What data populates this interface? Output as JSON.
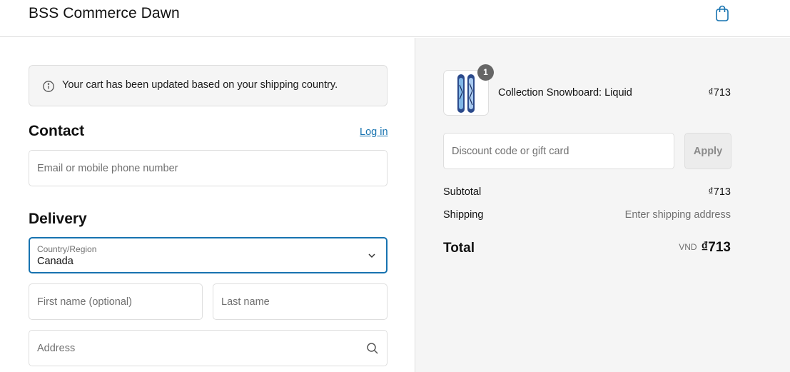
{
  "header": {
    "brand": "BSS Commerce Dawn",
    "cart_icon": "shopping-bag-icon"
  },
  "notice": {
    "icon": "info-icon",
    "text": "Your cart has been updated based on your shipping country."
  },
  "contact": {
    "title": "Contact",
    "login_label": "Log in",
    "email_placeholder": "Email or mobile phone number"
  },
  "delivery": {
    "title": "Delivery",
    "country_label": "Country/Region",
    "country_value": "Canada",
    "first_name_placeholder": "First name (optional)",
    "last_name_placeholder": "Last name",
    "address_placeholder": "Address"
  },
  "summary": {
    "product": {
      "name": "Collection Snowboard: Liquid",
      "price": "₫713",
      "quantity": "1"
    },
    "discount_placeholder": "Discount code or gift card",
    "apply_label": "Apply",
    "subtotal_label": "Subtotal",
    "subtotal_value": "₫713",
    "shipping_label": "Shipping",
    "shipping_value": "Enter shipping address",
    "total_label": "Total",
    "currency": "VND",
    "total_value": "₫713"
  },
  "colors": {
    "accent": "#1773b0",
    "summary_bg": "#f5f5f5",
    "border": "#dedede"
  }
}
